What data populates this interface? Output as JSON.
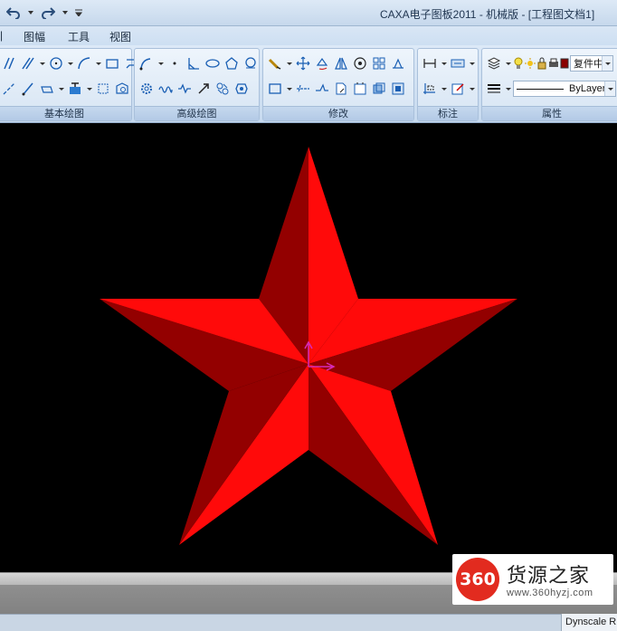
{
  "window": {
    "title": "CAXA电子图板2011 - 机械版 - [工程图文档1]",
    "quick_access": [
      "undo-icon",
      "redo-icon",
      "customize-icon"
    ]
  },
  "menu": {
    "items": [
      "图幅",
      "工具",
      "视图"
    ]
  },
  "ribbon": {
    "groups": [
      {
        "label": "基本绘图"
      },
      {
        "label": "高级绘图"
      },
      {
        "label": "修改"
      },
      {
        "label": "标注"
      },
      {
        "label": "属性"
      }
    ],
    "properties": {
      "layer_name": "复件中",
      "linetype": "ByLayer"
    }
  },
  "canvas": {
    "background": "#000000",
    "star_color_bright": "#ff0a0a",
    "star_color_dark": "#930000",
    "cursor_color": "#d62bb8"
  },
  "status": {
    "dynscale_text": "Dynscale R"
  },
  "watermark": {
    "logo_text": "360",
    "name": "货源之家",
    "url": "www.360hyzj.com"
  }
}
